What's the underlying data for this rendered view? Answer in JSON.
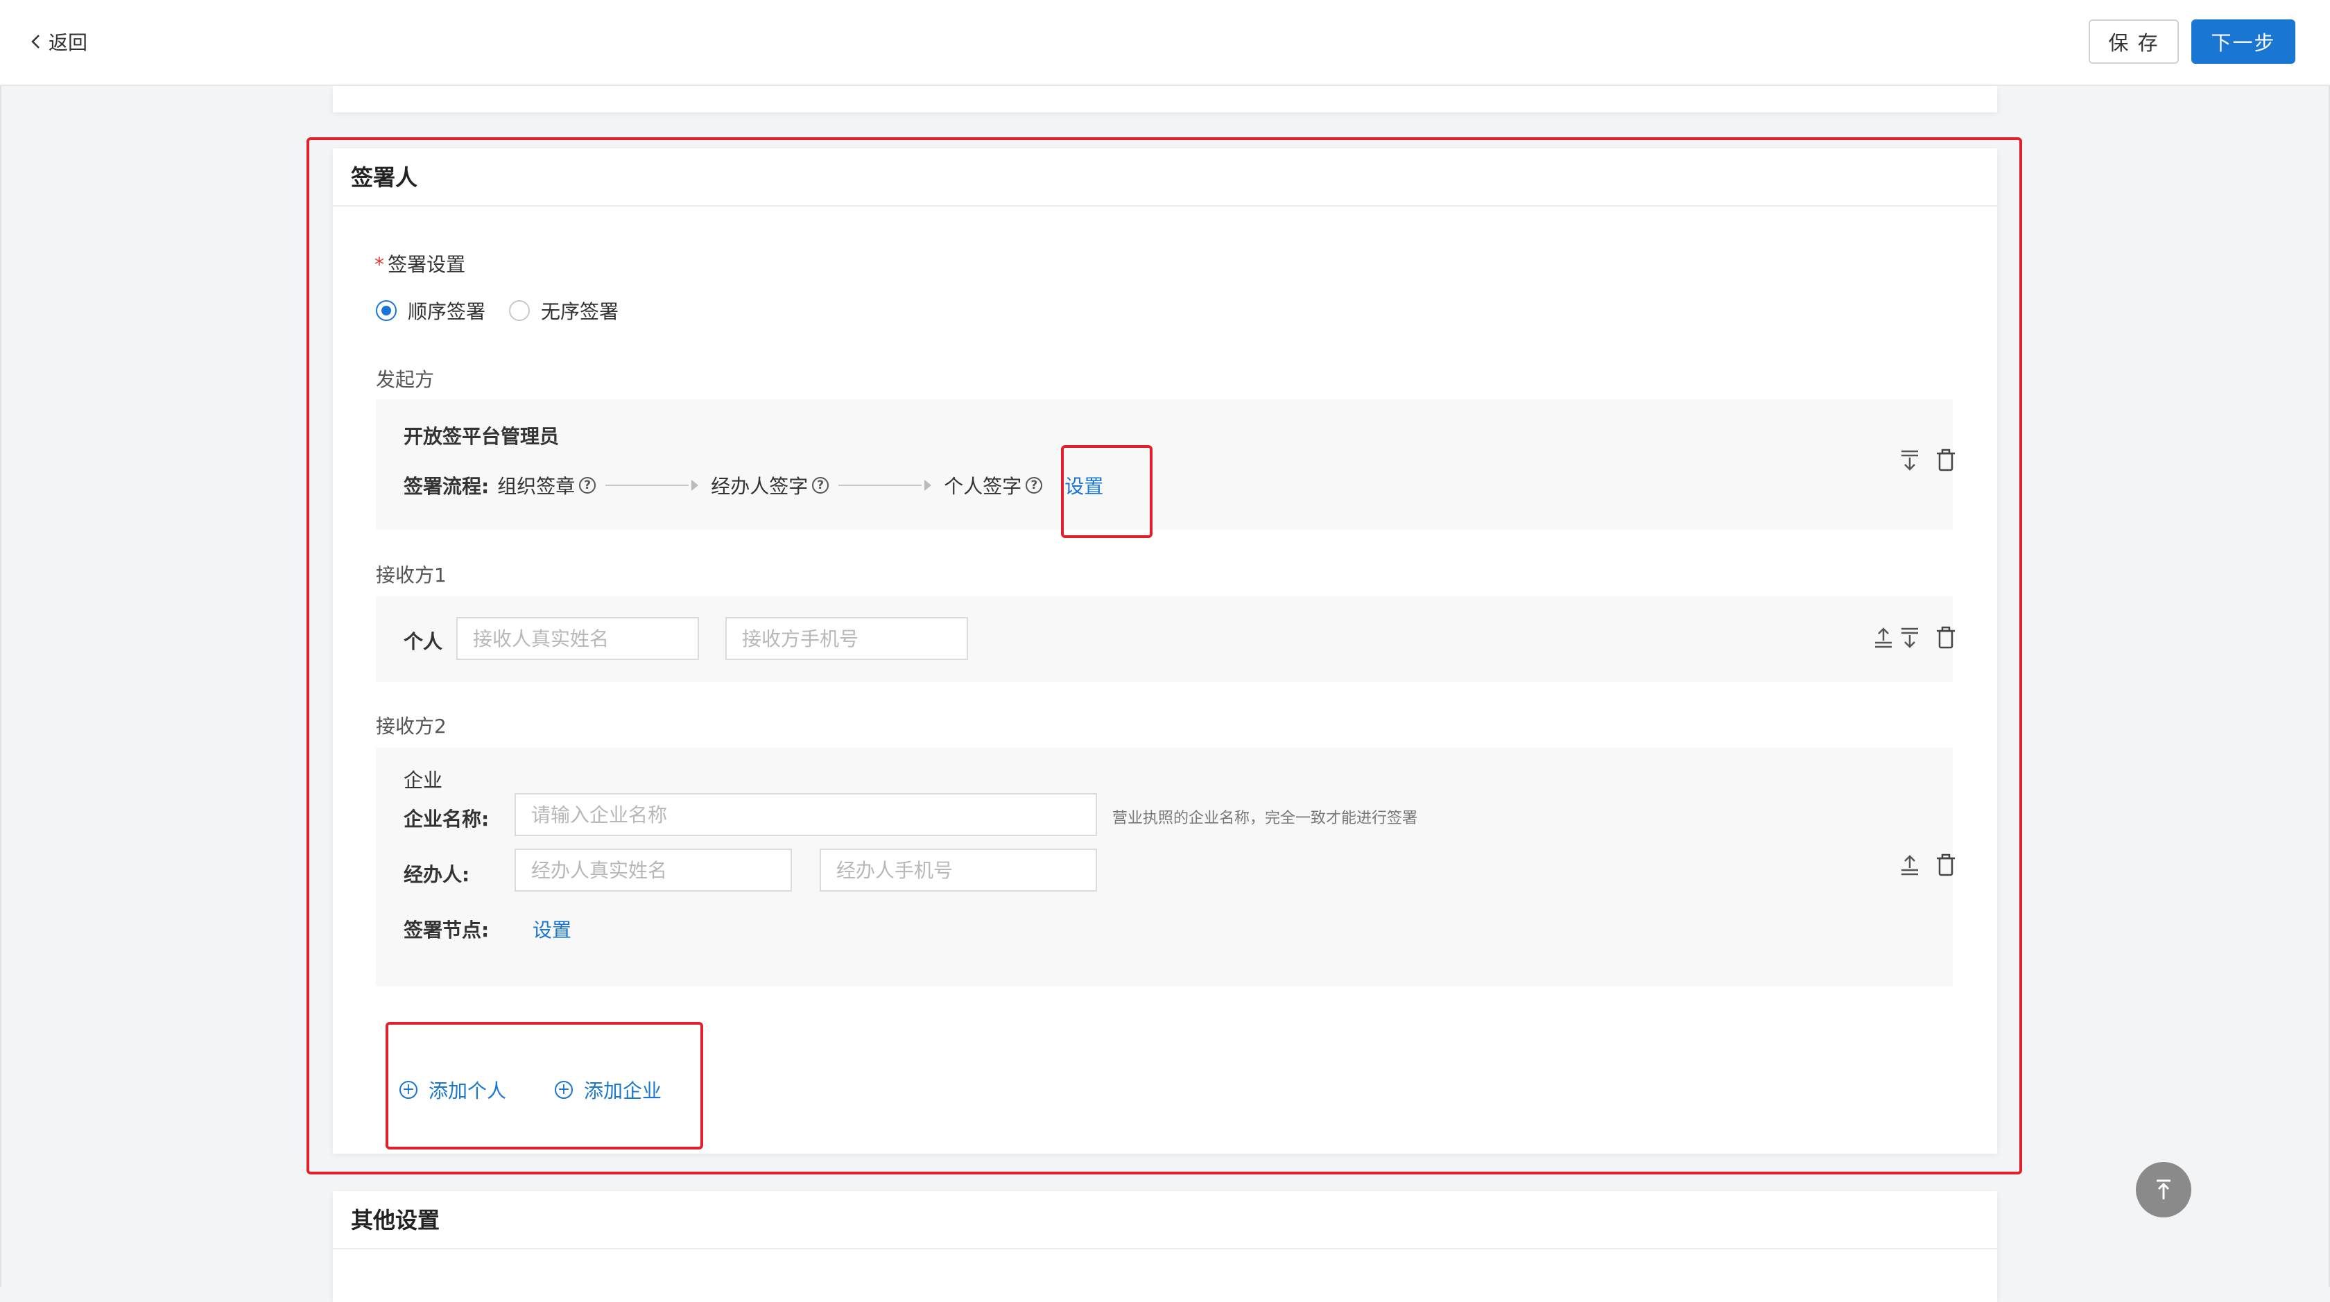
{
  "header": {
    "back_label": "返回",
    "save_label": "保 存",
    "next_label": "下一步"
  },
  "signer": {
    "title": "签署人",
    "settings_label": "签署设置",
    "required_mark": "*",
    "order_options": [
      {
        "label": "顺序签署",
        "selected": true
      },
      {
        "label": "无序签署",
        "selected": false
      }
    ],
    "initiator": {
      "section_label": "发起方",
      "name": "开放签平台管理员",
      "flow_label": "签署流程:",
      "steps": [
        "组织签章",
        "经办人签字",
        "个人签字"
      ],
      "set_link": "设置"
    },
    "receiver1": {
      "section_label": "接收方1",
      "type_label": "个人",
      "name_placeholder": "接收人真实姓名",
      "phone_placeholder": "接收方手机号"
    },
    "receiver2": {
      "section_label": "接收方2",
      "type_label": "企业",
      "company_label": "企业名称:",
      "company_placeholder": "请输入企业名称",
      "company_hint": "营业执照的企业名称，完全一致才能进行签署",
      "agent_label": "经办人:",
      "agent_name_placeholder": "经办人真实姓名",
      "agent_phone_placeholder": "经办人手机号",
      "node_label": "签署节点:",
      "node_link": "设置"
    },
    "add_person": "添加个人",
    "add_company": "添加企业"
  },
  "other": {
    "title": "其他设置"
  },
  "colors": {
    "accent": "#1976d2",
    "annotation": "#e0202a"
  }
}
